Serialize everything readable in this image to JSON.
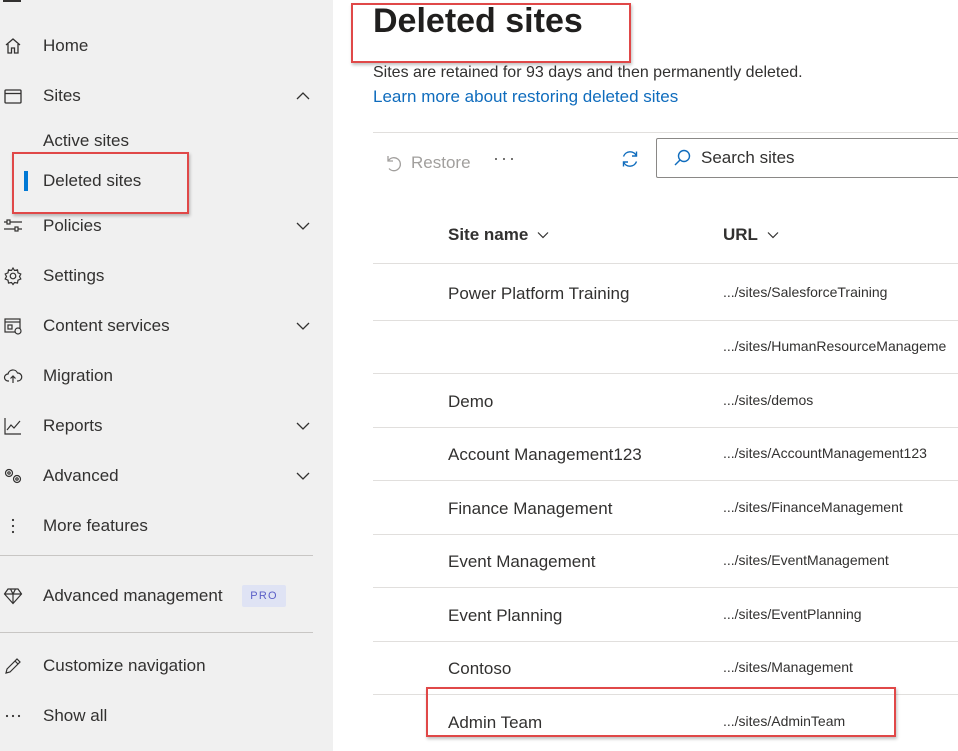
{
  "sidebar": {
    "items": [
      {
        "label": "Home",
        "icon": "home-icon"
      },
      {
        "label": "Sites",
        "icon": "browser-icon",
        "expanded": true
      },
      {
        "label": "Active sites"
      },
      {
        "label": "Deleted sites",
        "selected": true
      },
      {
        "label": "Policies",
        "icon": "sliders-icon"
      },
      {
        "label": "Settings",
        "icon": "gear-icon"
      },
      {
        "label": "Content services",
        "icon": "content-services-icon"
      },
      {
        "label": "Migration",
        "icon": "cloud-upload-icon"
      },
      {
        "label": "Reports",
        "icon": "chart-line-icon"
      },
      {
        "label": "Advanced",
        "icon": "gears-icon"
      },
      {
        "label": "More features",
        "icon": "vertical-ellipsis-icon"
      },
      {
        "label": "Advanced management",
        "icon": "diamond-icon",
        "badge": "PRO"
      },
      {
        "label": "Customize navigation",
        "icon": "pencil-icon"
      },
      {
        "label": "Show all",
        "icon": "ellipsis-icon"
      }
    ]
  },
  "main": {
    "title": "Deleted sites",
    "description": "Sites are retained for 93 days and then permanently deleted.",
    "learn_link": "Learn more about restoring deleted sites",
    "toolbar": {
      "restore_label": "Restore",
      "more_label": "···",
      "search_placeholder": "Search sites"
    },
    "columns": [
      "Site name",
      "URL"
    ],
    "rows": [
      {
        "name": "Power Platform Training",
        "url": ".../sites/SalesforceTraining"
      },
      {
        "name": "",
        "url": ".../sites/HumanResourceManageme"
      },
      {
        "name": "Demo",
        "url": ".../sites/demos"
      },
      {
        "name": "Account Management123",
        "url": ".../sites/AccountManagement123"
      },
      {
        "name": "Finance Management",
        "url": ".../sites/FinanceManagement"
      },
      {
        "name": "Event Management",
        "url": ".../sites/EventManagement"
      },
      {
        "name": "Event Planning",
        "url": ".../sites/EventPlanning"
      },
      {
        "name": "Contoso",
        "url": ".../sites/Management"
      },
      {
        "name": "Admin Team",
        "url": ".../sites/AdminTeam"
      }
    ]
  },
  "colors": {
    "accent": "#0078d4",
    "highlight": "#e04848",
    "link": "#0f6cbd"
  }
}
